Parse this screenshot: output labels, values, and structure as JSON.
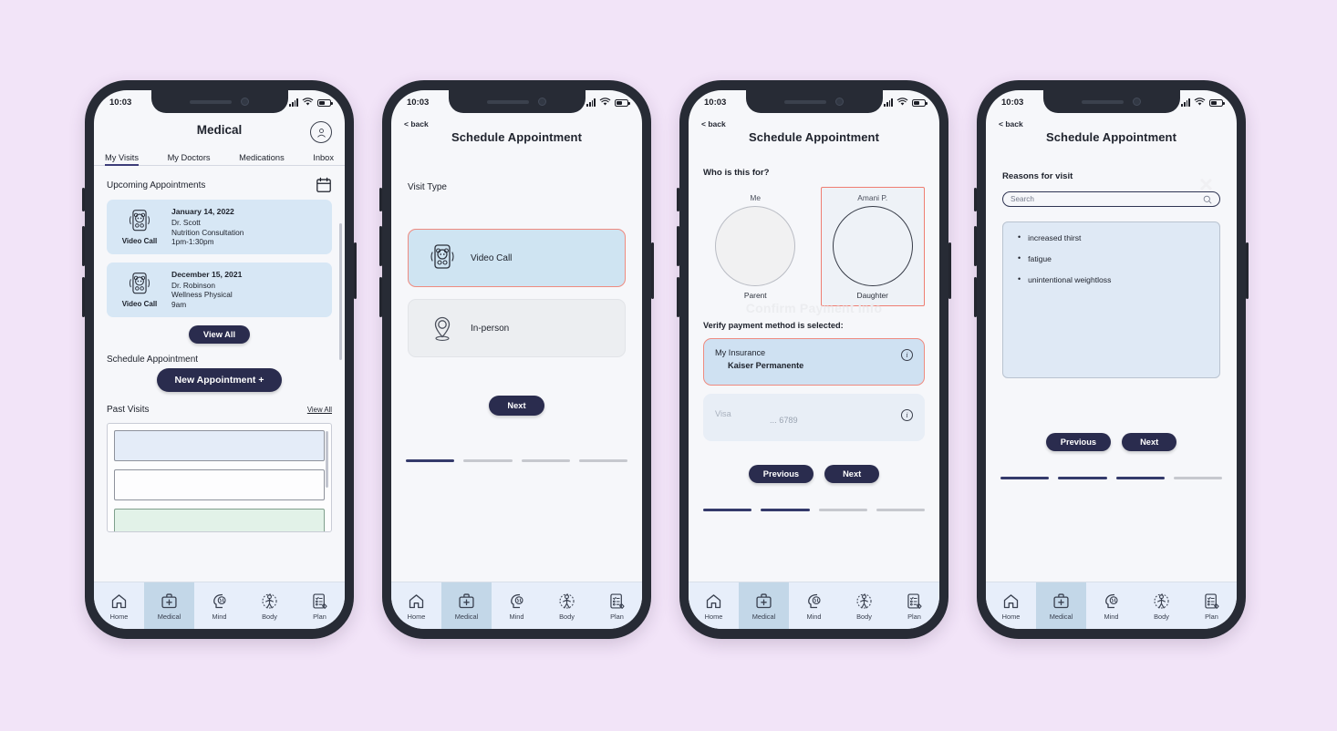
{
  "theme": {
    "page_background": "#f2e4f8",
    "accent_navy": "#2a2c4e",
    "selected_border": "#ef8b80",
    "selected_fill": "#cfe4f2",
    "nav_active_fill": "#c3d7e8"
  },
  "status_bar": {
    "time": "10:03"
  },
  "screen1": {
    "app_title": "Medical",
    "tabs": [
      {
        "label": "My Visits",
        "active": true
      },
      {
        "label": "My Doctors",
        "active": false
      },
      {
        "label": "Medications",
        "active": false
      },
      {
        "label": "Inbox",
        "active": false
      }
    ],
    "upcoming_heading": "Upcoming Appointments",
    "appointments": [
      {
        "type": "Video Call",
        "date": "January 14, 2022",
        "doctor": "Dr. Scott",
        "reason": "Nutrition Consultation",
        "time": "1pm-1:30pm"
      },
      {
        "type": "Video Call",
        "date": "December 15, 2021",
        "doctor": "Dr.  Robinson",
        "reason": "Wellness Physical",
        "time": "9am"
      }
    ],
    "view_all_button": "View All",
    "schedule_heading": "Schedule Appointment",
    "new_appointment_button": "New Appointment  +",
    "past_visits_heading": "Past Visits",
    "past_visits_link": "View All"
  },
  "screen2": {
    "back": "< back",
    "title": "Schedule Appointment",
    "section_label": "Visit Type",
    "options": [
      {
        "label": "Video Call",
        "icon": "video-call-icon",
        "selected": true
      },
      {
        "label": "In-person",
        "icon": "location-pin-icon",
        "selected": false
      }
    ],
    "next_button": "Next",
    "steps": [
      true,
      false,
      false,
      false
    ]
  },
  "screen3": {
    "back": "< back",
    "title": "Schedule Appointment",
    "question": "Who is this for?",
    "people": [
      {
        "name": "Me",
        "relation": "Parent",
        "selected": false
      },
      {
        "name": "Amani P.",
        "relation": "Daughter",
        "selected": true
      }
    ],
    "ghost_title": "Confirm Payment Info",
    "verify_label": "Verify payment method is selected:",
    "payment_methods": [
      {
        "title": "My Insurance",
        "detail": "Kaiser Permanente",
        "selected": true
      },
      {
        "title": "Visa",
        "detail": "... 6789",
        "selected": false
      }
    ],
    "previous_button": "Previous",
    "next_button": "Next",
    "steps": [
      true,
      true,
      false,
      false
    ]
  },
  "screen4": {
    "back": "< back",
    "title": "Schedule Appointment",
    "section_label": "Reasons for visit",
    "search_placeholder": "Search",
    "search_value": "",
    "reasons": [
      "increased thirst",
      "fatigue",
      "unintentional weightloss"
    ],
    "ghost_x": "×",
    "previous_button": "Previous",
    "next_button": "Next",
    "steps": [
      true,
      true,
      true,
      false
    ]
  },
  "bottom_nav": [
    {
      "label": "Home",
      "icon": "home-icon",
      "active": false
    },
    {
      "label": "Medical",
      "icon": "medical-kit-icon",
      "active": true
    },
    {
      "label": "Mind",
      "icon": "mind-head-icon",
      "active": false
    },
    {
      "label": "Body",
      "icon": "body-icon",
      "active": false
    },
    {
      "label": "Plan",
      "icon": "clipboard-pencil-icon",
      "active": false
    }
  ]
}
